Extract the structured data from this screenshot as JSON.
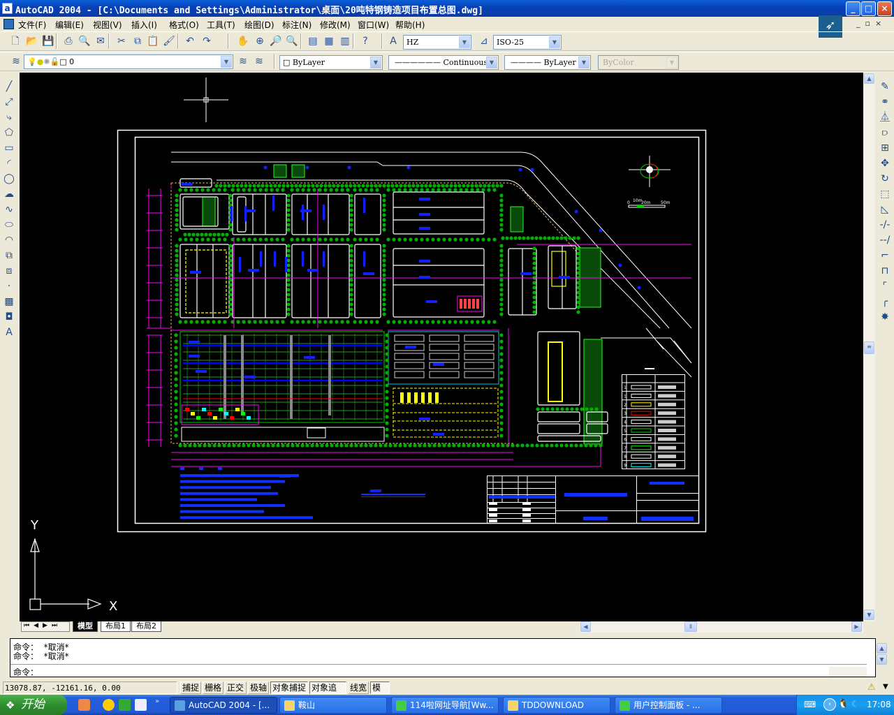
{
  "window": {
    "title": "AutoCAD 2004 - [C:\\Documents and Settings\\Administrator\\桌面\\20吨特钢铸造项目布置总图.dwg]",
    "app_icon": "a",
    "buttons": {
      "minimize": "_",
      "maximize": "□",
      "close": "×"
    }
  },
  "menu": [
    "文件(F)",
    "编辑(E)",
    "视图(V)",
    "插入(I)",
    "格式(O)",
    "工具(T)",
    "绘图(D)",
    "标注(N)",
    "修改(M)",
    "窗口(W)",
    "帮助(H)"
  ],
  "toolbar": {
    "standard_icons": [
      "new-icon",
      "open-icon",
      "save-icon",
      "print-icon",
      "print-preview-icon",
      "publish-icon",
      "cut-icon",
      "copy-icon",
      "paste-icon",
      "match-properties-icon",
      "undo-icon",
      "redo-icon",
      "pan-icon",
      "zoom-realtime-icon",
      "zoom-window-icon",
      "zoom-previous-icon",
      "properties-icon",
      "design-center-icon",
      "tool-palettes-icon",
      "help-icon"
    ],
    "text_style": "HZ",
    "dim_style": "ISO-25"
  },
  "properties": {
    "layer": "0",
    "color": "ByLayer",
    "linetype": "Continuous",
    "lineweight": "ByLayer",
    "plotstyle": "ByColor"
  },
  "draw_toolbar": [
    "line-icon",
    "construction-line-icon",
    "polyline-icon",
    "polygon-icon",
    "rectangle-icon",
    "arc-icon",
    "circle-icon",
    "revision-cloud-icon",
    "spline-icon",
    "ellipse-icon",
    "ellipse-arc-icon",
    "insert-block-icon",
    "make-block-icon",
    "point-icon",
    "hatch-icon",
    "region-icon",
    "multiline-text-icon"
  ],
  "modify_toolbar": [
    "erase-icon",
    "copy-object-icon",
    "mirror-icon",
    "offset-icon",
    "array-icon",
    "move-icon",
    "rotate-icon",
    "scale-icon",
    "stretch-icon",
    "trim-icon",
    "extend-icon",
    "break-at-point-icon",
    "break-icon",
    "chamfer-icon",
    "fillet-icon",
    "explode-icon"
  ],
  "drawing": {
    "ucs": {
      "x": "X",
      "y": "Y"
    },
    "scale_bar": [
      "0",
      "10m",
      "20m",
      "50m"
    ],
    "legend_numbers": [
      "1",
      "1",
      "2",
      "3",
      "4",
      "5",
      "6",
      "7",
      "8",
      "9"
    ]
  },
  "layout_tabs": [
    "模型",
    "布局1",
    "布局2"
  ],
  "active_tab": "模型",
  "command": {
    "history": [
      "命令：  *取消*",
      "命令：  *取消*"
    ],
    "prompt": "命令："
  },
  "status": {
    "coordinates": "13078.87, -12161.16, 0.00",
    "toggles": [
      {
        "label": "捕捉",
        "on": false
      },
      {
        "label": "栅格",
        "on": false
      },
      {
        "label": "正交",
        "on": false
      },
      {
        "label": "极轴",
        "on": false
      },
      {
        "label": "对象捕捉",
        "on": true
      },
      {
        "label": "对象追踪",
        "on": true
      },
      {
        "label": "线宽",
        "on": false
      },
      {
        "label": "模型",
        "on": true
      }
    ]
  },
  "taskbar": {
    "start": "开始",
    "tasks": [
      {
        "label": "AutoCAD 2004 - [...",
        "icon": "autocad-icon",
        "active": true
      },
      {
        "label": "鞍山",
        "icon": "folder-icon",
        "active": false
      },
      {
        "label": "114啦网址导航[Ww...",
        "icon": "ie-icon",
        "active": false
      },
      {
        "label": "TDDOWNLOAD",
        "icon": "folder-icon",
        "active": false
      },
      {
        "label": "用户控制面板 - ...",
        "icon": "ie-icon",
        "active": false
      }
    ],
    "clock": "17:08"
  },
  "colors": {
    "canvas": "#000000",
    "titlebar": "#0a46c0",
    "taskbar": "#245edb",
    "dimension": "#ff00ff",
    "trees": "#00a000",
    "labels": "#0000ff"
  }
}
